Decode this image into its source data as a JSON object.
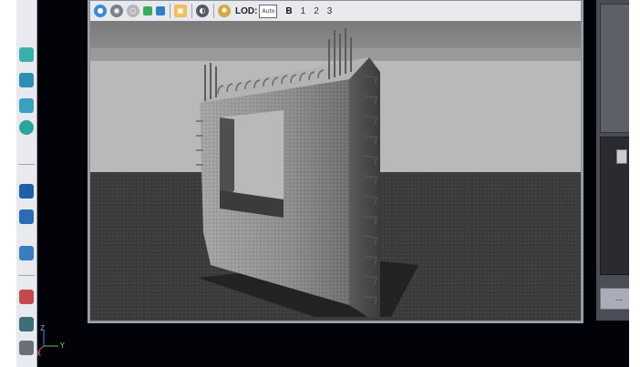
{
  "viewport_toolbar": {
    "lod_label": "LOD:",
    "lod_value": "Auto",
    "lod_level_b": "B",
    "lod_level_1": "1",
    "lod_level_2": "2",
    "lod_level_3": "3"
  },
  "right_panel": {
    "dropdown_value": "..."
  },
  "axis_gizmo": {
    "z_label": "Z",
    "y_label": "Y",
    "x_label": "X"
  },
  "colors": {
    "sky": "#b9b9b9",
    "horizon": "#8d8d8d",
    "ground": "#3a3a3a",
    "wall": "#8e8e8e",
    "screen_bg": "#020209"
  }
}
